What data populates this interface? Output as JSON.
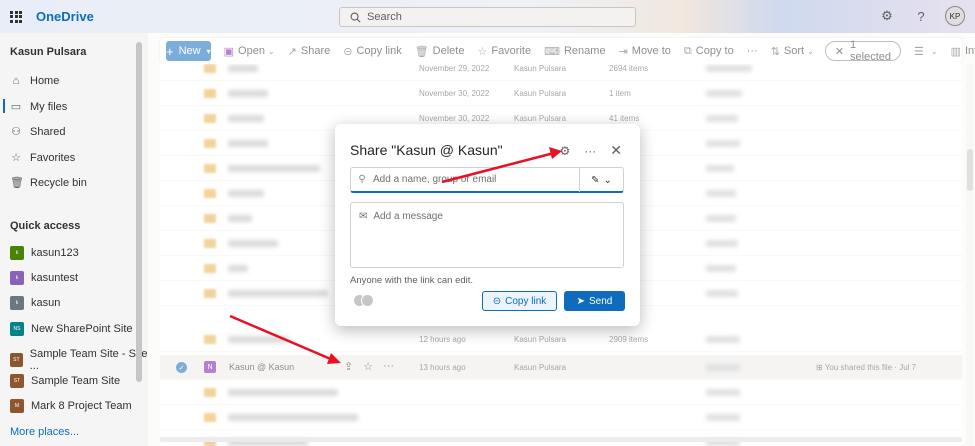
{
  "app": {
    "name": "OneDrive",
    "search_placeholder": "Search",
    "user_initials": "KP"
  },
  "sidebar": {
    "user_name": "Kasun Pulsara",
    "nav": [
      {
        "label": "Home",
        "icon": "home-icon"
      },
      {
        "label": "My files",
        "icon": "folder-icon",
        "active": true
      },
      {
        "label": "Shared",
        "icon": "people-icon"
      },
      {
        "label": "Favorites",
        "icon": "star-icon"
      },
      {
        "label": "Recycle bin",
        "icon": "trash-icon"
      }
    ],
    "quick_access_title": "Quick access",
    "quick_access": [
      {
        "label": "kasun123",
        "tile": "k",
        "color": "#498205"
      },
      {
        "label": "kasuntest",
        "tile": "k",
        "color": "#8764b8"
      },
      {
        "label": "kasun",
        "tile": "k",
        "color": "#69797e"
      },
      {
        "label": "New SharePoint Site",
        "tile": "NS",
        "color": "#038387"
      },
      {
        "label": "Sample Team Site - Site ...",
        "tile": "ST",
        "color": "#8e562e"
      },
      {
        "label": "Sample Team Site",
        "tile": "ST",
        "color": "#8e562e"
      },
      {
        "label": "Mark 8 Project Team",
        "tile": "M",
        "color": "#8e562e"
      }
    ],
    "more_places": "More places..."
  },
  "commands": {
    "new": "New",
    "open": "Open",
    "share": "Share",
    "copy_link": "Copy link",
    "delete": "Delete",
    "favorite": "Favorite",
    "rename": "Rename",
    "move_to": "Move to",
    "copy_to": "Copy to",
    "more": "···",
    "sort": "Sort",
    "selected": "1 selected",
    "info": "Info"
  },
  "files": {
    "rows": [
      {
        "modified": "November 29, 2022",
        "by": "Kasun Pulsara",
        "size": "2694 items"
      },
      {
        "modified": "November 30, 2022",
        "by": "Kasun Pulsara",
        "size": "1 item"
      },
      {
        "modified": "November 30, 2022",
        "by": "Kasun Pulsara",
        "size": "41 items"
      },
      {
        "modified": "",
        "by": "",
        "size": ""
      },
      {
        "modified": "",
        "by": "",
        "size": ""
      },
      {
        "modified": "",
        "by": "",
        "size": ""
      },
      {
        "modified": "",
        "by": "",
        "size": ""
      },
      {
        "modified": "",
        "by": "",
        "size": ""
      },
      {
        "modified": "",
        "by": "",
        "size": ""
      },
      {
        "modified": "",
        "by": "",
        "size": ""
      },
      {
        "modified": "12 hours ago",
        "by": "Kasun Pulsara",
        "size": "2909 items"
      }
    ],
    "selected_row": {
      "name": "Kasun @ Kasun",
      "modified": "13 hours ago",
      "by": "Kasun Pulsara",
      "activity": "You shared this file · Jul 7"
    }
  },
  "share_dialog": {
    "title": "Share \"Kasun @ Kasun\"",
    "name_placeholder": "Add a name, group or email",
    "message_placeholder": "Add a message",
    "link_info": "Anyone with the link can edit.",
    "copy_link": "Copy link",
    "send": "Send"
  },
  "colors": {
    "accent": "#0f6cbd",
    "annotation": "#e81123"
  }
}
